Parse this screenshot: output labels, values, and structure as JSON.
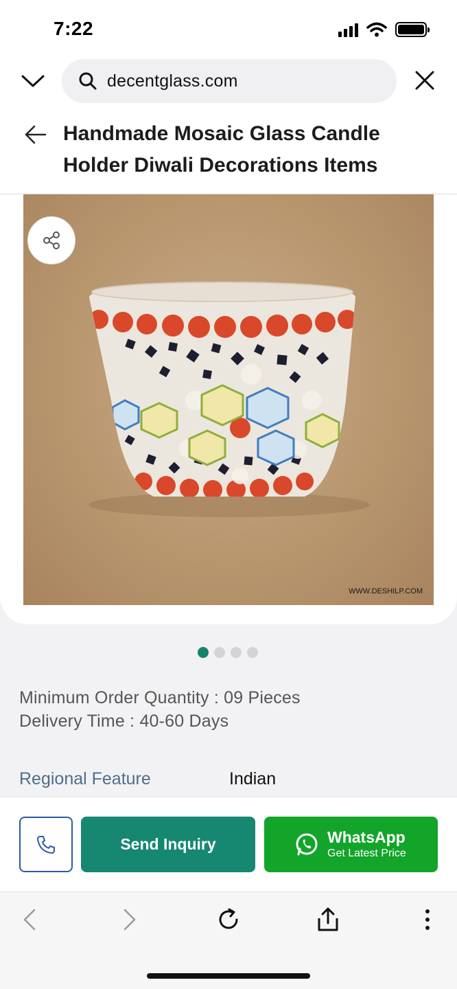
{
  "status_bar": {
    "time": "7:22"
  },
  "browser": {
    "url": "decentglass.com"
  },
  "header": {
    "title": "Handmade Mosaic Glass Candle Holder Diwali Decorations Items"
  },
  "gallery": {
    "watermark": "WWW.DESHILP.COM",
    "dots_total": 4,
    "active_index": 0
  },
  "specs": {
    "min_order": "Minimum Order Quantity : 09 Pieces",
    "delivery": "Delivery Time : 40-60 Days",
    "feature_label": "Regional Feature",
    "feature_value": "Indian"
  },
  "actions": {
    "inquiry_label": "Send Inquiry",
    "whatsapp_title": "WhatsApp",
    "whatsapp_sub": "Get Latest Price"
  },
  "colors": {
    "accent_green": "#168770",
    "whatsapp_green": "#12a52a",
    "call_border": "#2b5aa6",
    "dot_active": "#16836c"
  },
  "icons": [
    "chevron-down-icon",
    "search-icon",
    "close-icon",
    "back-arrow-icon",
    "share-icon",
    "phone-icon",
    "whatsapp-icon",
    "nav-back-icon",
    "nav-forward-icon",
    "reload-icon",
    "share-upload-icon",
    "more-icon"
  ]
}
